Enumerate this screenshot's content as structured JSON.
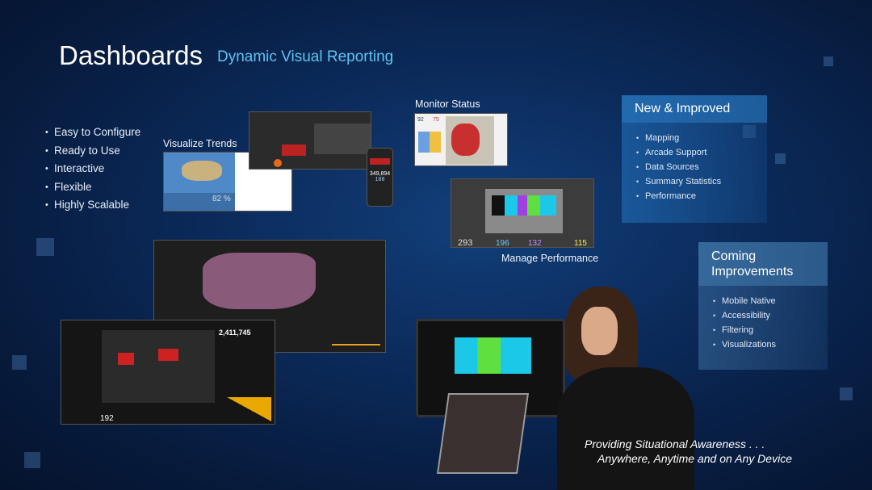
{
  "header": {
    "title": "Dashboards",
    "subtitle": "Dynamic Visual Reporting"
  },
  "features": [
    "Easy to Configure",
    "Ready to Use",
    "Interactive",
    "Flexible",
    "Highly Scalable"
  ],
  "labels": {
    "trends": "Visualize Trends",
    "monitor": "Monitor Status",
    "manage": "Manage Performance"
  },
  "new_improved": {
    "title": "New & Improved",
    "items": [
      "Mapping",
      "Arcade Support",
      "Data Sources",
      "Summary Statistics",
      "Performance"
    ]
  },
  "coming": {
    "title": "Coming Improvements",
    "items": [
      "Mobile Native",
      "Accessibility",
      "Filtering",
      "Visualizations"
    ]
  },
  "tagline": {
    "line1": "Providing Situational Awareness . . .",
    "line2": "Anywhere, Anytime and on Any Device"
  },
  "screens": {
    "phone_value1": "349,894",
    "phone_value2": "188",
    "monitor_values": [
      "92",
      "75"
    ],
    "perf_values": [
      "293",
      "196",
      "132",
      "115"
    ],
    "covid_total": "2,411,745",
    "covid_count": "192",
    "trend_value": "82 %"
  },
  "colors": {
    "accent": "#5fc3f0",
    "background": "#0b2a5a"
  }
}
